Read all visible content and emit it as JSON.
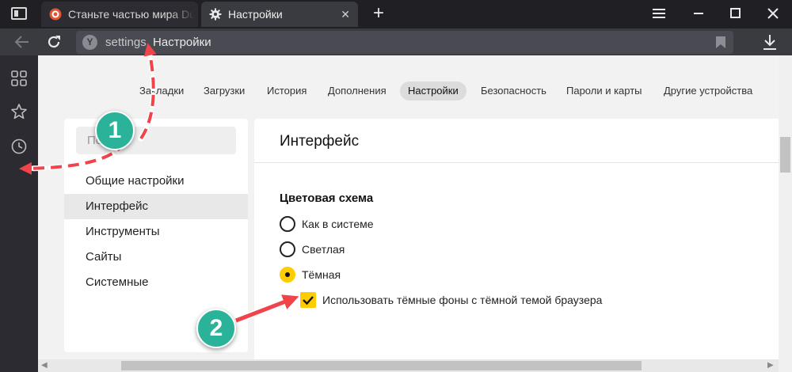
{
  "browser": {
    "tabs": [
      {
        "label": "Станьте частью мира Duckduck",
        "active": false
      },
      {
        "label": "Настройки",
        "active": true
      }
    ],
    "address": {
      "host": "settings",
      "title": "Настройки"
    }
  },
  "settings": {
    "top_nav": [
      {
        "label": "Закладки",
        "selected": false
      },
      {
        "label": "Загрузки",
        "selected": false
      },
      {
        "label": "История",
        "selected": false
      },
      {
        "label": "Дополнения",
        "selected": false
      },
      {
        "label": "Настройки",
        "selected": true
      },
      {
        "label": "Безопасность",
        "selected": false
      },
      {
        "label": "Пароли и карты",
        "selected": false
      },
      {
        "label": "Другие устройства",
        "selected": false
      }
    ],
    "search_placeholder": "Поиск",
    "menu": [
      {
        "label": "Общие настройки",
        "selected": false
      },
      {
        "label": "Интерфейс",
        "selected": true
      },
      {
        "label": "Инструменты",
        "selected": false
      },
      {
        "label": "Сайты",
        "selected": false
      },
      {
        "label": "Системные",
        "selected": false
      }
    ],
    "section_title": "Интерфейс",
    "color_scheme": {
      "title": "Цветовая схема",
      "options": [
        {
          "label": "Как в системе",
          "checked": false
        },
        {
          "label": "Светлая",
          "checked": false
        },
        {
          "label": "Тёмная",
          "checked": true
        }
      ],
      "dark_backgrounds": {
        "label": "Использовать тёмные фоны с тёмной темой браузера",
        "checked": true
      }
    }
  },
  "annotations": [
    {
      "number": "1"
    },
    {
      "number": "2"
    }
  ],
  "colors": {
    "accent_yellow": "#ffcc00",
    "annotation_red": "#f0434a",
    "annotation_badge": "#2bb39a",
    "browser_dark": "#1f1f24"
  }
}
